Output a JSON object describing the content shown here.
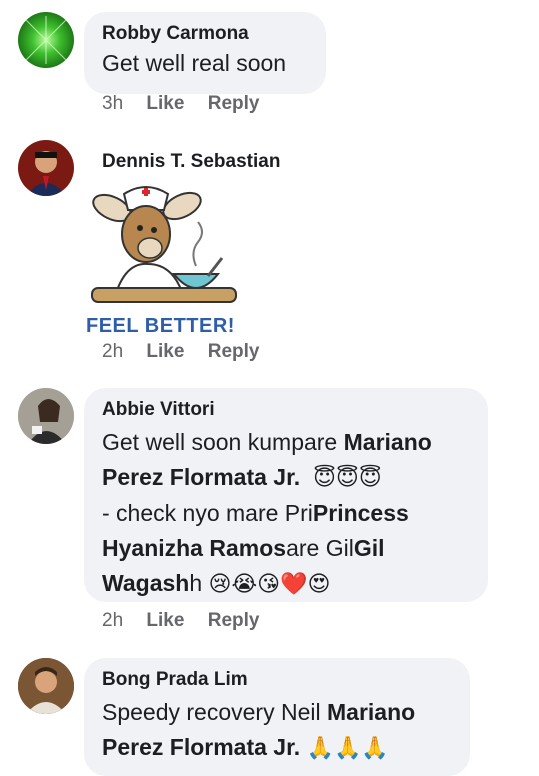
{
  "comments": [
    {
      "author": "Robby Carmona",
      "text": "Get well real soon",
      "time": "3h",
      "like": "Like",
      "reply": "Reply"
    },
    {
      "author": "Dennis T. Sebastian",
      "sticker_text": "FEEL BETTER!",
      "time": "2h",
      "like": "Like",
      "reply": "Reply"
    },
    {
      "author": "Abbie Vittori",
      "line1_plain": "Get well soon kumpare ",
      "line1_bold": "Mariano",
      "line2_bold": "Perez Flormata Jr.",
      "line2_emoji": "😇😇😇",
      "line3_plain": "- check nyo mare Pri",
      "line3_bold": "Princess",
      "line4_bold": "Hyanizha Ramos",
      "line4_plain": "are Gil",
      "line4_bold2": "Gil",
      "line5_bold": "Wagash",
      "line5_plain": "h ",
      "line5_emoji": "😢😭😘❤️😍",
      "time": "2h",
      "like": "Like",
      "reply": "Reply"
    },
    {
      "author": "Bong Prada Lim",
      "line1_plain": "Speedy recovery Neil ",
      "line1_bold": "Mariano",
      "line2_bold": "Perez Flormata Jr.",
      "line2_emoji": "🙏🙏🙏"
    }
  ]
}
